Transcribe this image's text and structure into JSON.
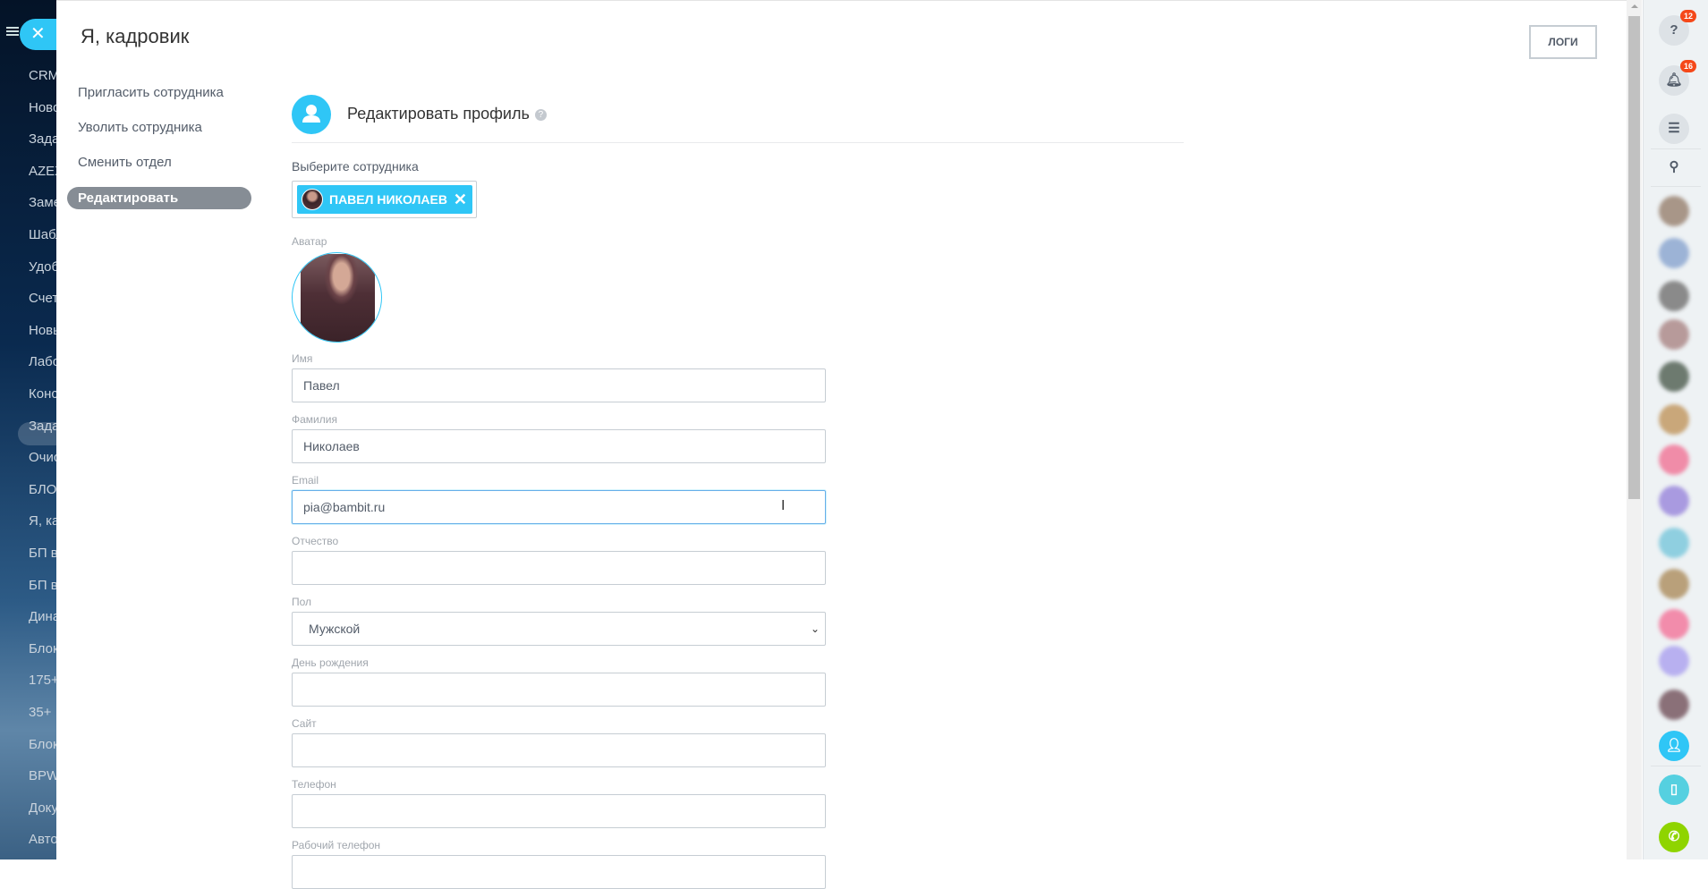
{
  "left_menu": {
    "items": [
      "CRM",
      "Новости",
      "Задачи",
      "AZEX",
      "Заметки",
      "Шаблоны",
      "Удобно",
      "Счета",
      "Новые",
      "Лаборатория",
      "Конструктор",
      "Задачи",
      "Очистка",
      "БЛОГ",
      "Я, кадровик",
      "БП в",
      "БП в",
      "Динамика",
      "Блоки",
      "175+",
      "35+",
      "Блоки",
      "BPW",
      "Документы",
      "Автоматизация"
    ],
    "active_index": 14
  },
  "slider": {
    "title": "Я, кадровик",
    "logs_label": "ЛОГИ",
    "menu": [
      "Пригласить сотрудника",
      "Уволить сотрудника",
      "Сменить отдел",
      "Редактировать"
    ]
  },
  "form": {
    "heading": "Редактировать профиль",
    "help_icon": "?",
    "employee_label": "Выберите сотрудника",
    "employee_chip": "ПАВЕЛ НИКОЛАЕВ",
    "avatar_label": "Аватар",
    "fields": [
      {
        "label": "Имя",
        "value": "Павел"
      },
      {
        "label": "Фамилия",
        "value": "Николаев"
      },
      {
        "label": "Email",
        "value": "pia@bambit.ru"
      },
      {
        "label": "Отчество",
        "value": ""
      },
      {
        "label": "Пол",
        "value": "Мужской"
      },
      {
        "label": "День рождения",
        "value": ""
      },
      {
        "label": "Сайт",
        "value": ""
      },
      {
        "label": "Телефон",
        "value": ""
      },
      {
        "label": "Рабочий телефон",
        "value": ""
      }
    ]
  },
  "right_bar": {
    "help_badge": "12",
    "notifications_badge": "16"
  },
  "colors": {
    "accent": "#2fc6f6",
    "badge": "#f54819",
    "call": "#8fd400"
  }
}
